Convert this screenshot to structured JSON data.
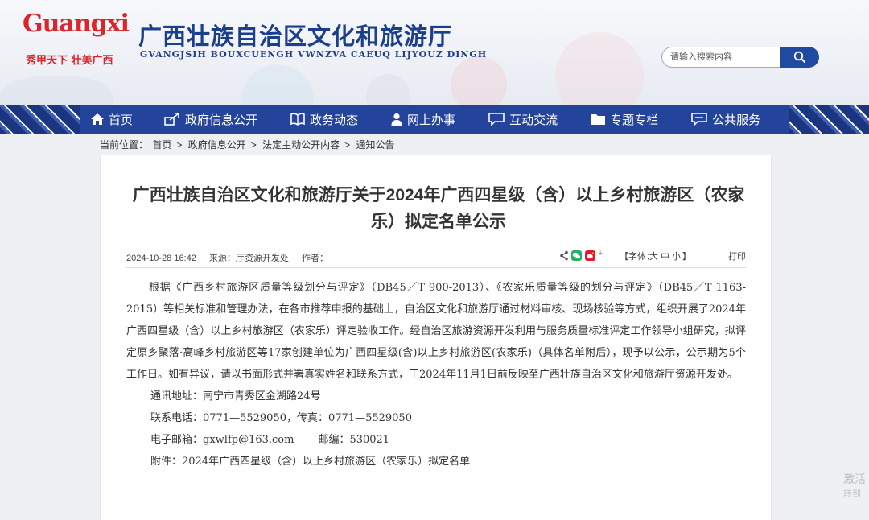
{
  "header": {
    "logo_text": "Guangxi",
    "logo_slogan": "秀甲天下 壮美广西",
    "title": "广西壮族自治区文化和旅游厅",
    "subtitle": "GVANGJSIH BOUXCUENGH VWNZVA CAEUQ LIJYOUZ DINGH",
    "search_placeholder": "请输入搜索内容"
  },
  "nav": {
    "items": [
      {
        "label": "首页",
        "icon": "home-icon"
      },
      {
        "label": "政府信息公开",
        "icon": "share-icon"
      },
      {
        "label": "政务动态",
        "icon": "book-icon"
      },
      {
        "label": "网上办事",
        "icon": "person-icon"
      },
      {
        "label": "互动交流",
        "icon": "chat-icon"
      },
      {
        "label": "专题专栏",
        "icon": "folder-icon"
      },
      {
        "label": "公共服务",
        "icon": "comment-icon"
      }
    ]
  },
  "breadcrumb": {
    "prefix": "当前位置：",
    "items": [
      "首页",
      "政府信息公开",
      "法定主动公开内容",
      "通知公告"
    ],
    "separator": ">"
  },
  "article": {
    "title": "广西壮族自治区文化和旅游厅关于2024年广西四星级（含）以上乡村旅游区（农家乐）拟定名单公示",
    "date": "2024-10-28 16:42",
    "source": "来源：厅资源开发处",
    "author": "作者：",
    "font_size_label": "【字体：",
    "font_sizes": [
      "大",
      "中",
      "小"
    ],
    "font_size_end": "】",
    "print_label": "打印",
    "paragraph": "根据《广西乡村旅游区质量等级划分与评定》（DB45／T 900-2013）、《农家乐质量等级的划分与评定》（DB45／T 1163-2015）等相关标准和管理办法，在各市推荐申报的基础上，自治区文化和旅游厅通过材料审核、现场核验等方式，组织开展了2024年广西四星级（含）以上乡村旅游区（农家乐）评定验收工作。经自治区旅游资源开发利用与服务质量标准评定工作领导小组研究，拟评定原乡聚落·高峰乡村旅游区等17家创建单位为广西四星级(含)以上乡村旅游区(农家乐)（具体名单附后），现予以公示，公示期为5个工作日。如有异议，请以书面形式并署真实姓名和联系方式，于2024年11月1日前反映至广西壮族自治区文化和旅游厅资源开发处。",
    "address": "通讯地址：南宁市青秀区金湖路24号",
    "phone": "联系电话：0771—5529050，传真：0771—5529050",
    "email": "电子邮箱：gxwlfp@163.com",
    "postcode": "邮编：530021",
    "attachment": "附件：2024年广西四星级（含）以上乡村旅游区（农家乐）拟定名单"
  },
  "watermark": {
    "line1": "激活",
    "line2": "转到"
  },
  "colors": {
    "nav_bg": "#24439a",
    "title_blue": "#1c3f8b",
    "logo_red": "#d8262c",
    "wechat_green": "#2aae67",
    "weibo_red": "#e6162d"
  }
}
